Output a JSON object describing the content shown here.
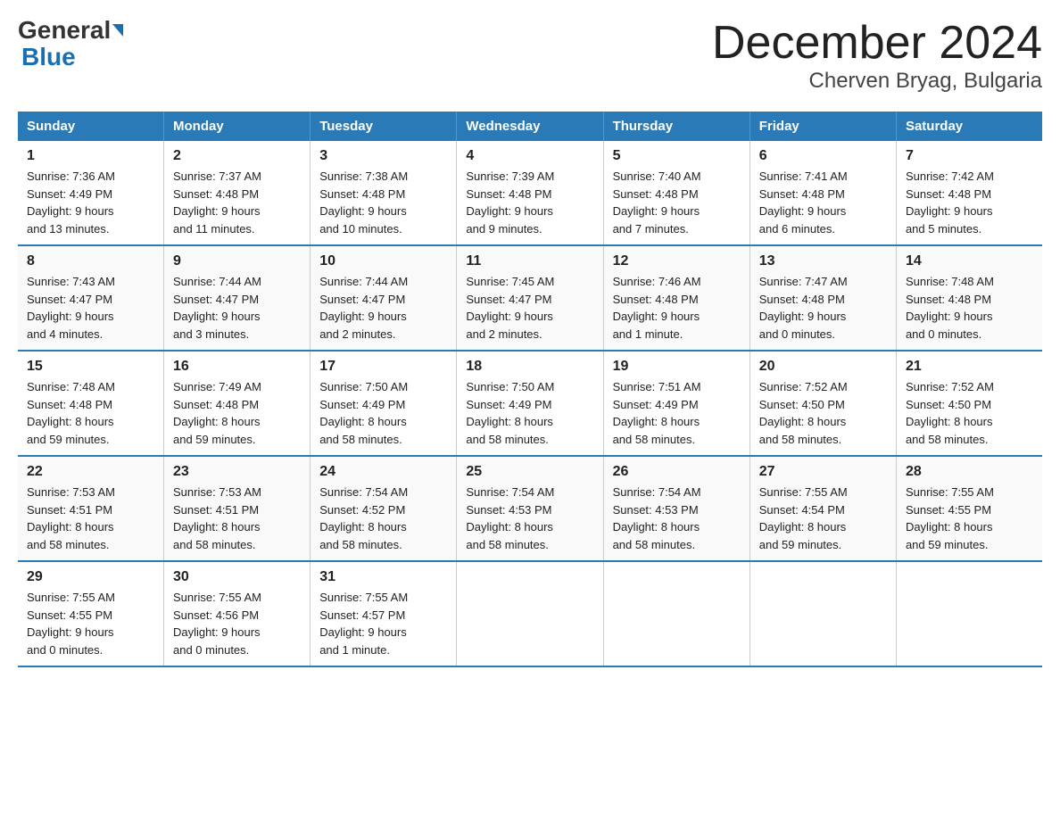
{
  "header": {
    "logo_general": "General",
    "logo_blue": "Blue",
    "title": "December 2024",
    "subtitle": "Cherven Bryag, Bulgaria"
  },
  "days_header": [
    "Sunday",
    "Monday",
    "Tuesday",
    "Wednesday",
    "Thursday",
    "Friday",
    "Saturday"
  ],
  "weeks": [
    [
      {
        "day": "1",
        "sunrise": "7:36 AM",
        "sunset": "4:49 PM",
        "daylight": "9 hours and 13 minutes."
      },
      {
        "day": "2",
        "sunrise": "7:37 AM",
        "sunset": "4:48 PM",
        "daylight": "9 hours and 11 minutes."
      },
      {
        "day": "3",
        "sunrise": "7:38 AM",
        "sunset": "4:48 PM",
        "daylight": "9 hours and 10 minutes."
      },
      {
        "day": "4",
        "sunrise": "7:39 AM",
        "sunset": "4:48 PM",
        "daylight": "9 hours and 9 minutes."
      },
      {
        "day": "5",
        "sunrise": "7:40 AM",
        "sunset": "4:48 PM",
        "daylight": "9 hours and 7 minutes."
      },
      {
        "day": "6",
        "sunrise": "7:41 AM",
        "sunset": "4:48 PM",
        "daylight": "9 hours and 6 minutes."
      },
      {
        "day": "7",
        "sunrise": "7:42 AM",
        "sunset": "4:48 PM",
        "daylight": "9 hours and 5 minutes."
      }
    ],
    [
      {
        "day": "8",
        "sunrise": "7:43 AM",
        "sunset": "4:47 PM",
        "daylight": "9 hours and 4 minutes."
      },
      {
        "day": "9",
        "sunrise": "7:44 AM",
        "sunset": "4:47 PM",
        "daylight": "9 hours and 3 minutes."
      },
      {
        "day": "10",
        "sunrise": "7:44 AM",
        "sunset": "4:47 PM",
        "daylight": "9 hours and 2 minutes."
      },
      {
        "day": "11",
        "sunrise": "7:45 AM",
        "sunset": "4:47 PM",
        "daylight": "9 hours and 2 minutes."
      },
      {
        "day": "12",
        "sunrise": "7:46 AM",
        "sunset": "4:48 PM",
        "daylight": "9 hours and 1 minute."
      },
      {
        "day": "13",
        "sunrise": "7:47 AM",
        "sunset": "4:48 PM",
        "daylight": "9 hours and 0 minutes."
      },
      {
        "day": "14",
        "sunrise": "7:48 AM",
        "sunset": "4:48 PM",
        "daylight": "9 hours and 0 minutes."
      }
    ],
    [
      {
        "day": "15",
        "sunrise": "7:48 AM",
        "sunset": "4:48 PM",
        "daylight": "8 hours and 59 minutes."
      },
      {
        "day": "16",
        "sunrise": "7:49 AM",
        "sunset": "4:48 PM",
        "daylight": "8 hours and 59 minutes."
      },
      {
        "day": "17",
        "sunrise": "7:50 AM",
        "sunset": "4:49 PM",
        "daylight": "8 hours and 58 minutes."
      },
      {
        "day": "18",
        "sunrise": "7:50 AM",
        "sunset": "4:49 PM",
        "daylight": "8 hours and 58 minutes."
      },
      {
        "day": "19",
        "sunrise": "7:51 AM",
        "sunset": "4:49 PM",
        "daylight": "8 hours and 58 minutes."
      },
      {
        "day": "20",
        "sunrise": "7:52 AM",
        "sunset": "4:50 PM",
        "daylight": "8 hours and 58 minutes."
      },
      {
        "day": "21",
        "sunrise": "7:52 AM",
        "sunset": "4:50 PM",
        "daylight": "8 hours and 58 minutes."
      }
    ],
    [
      {
        "day": "22",
        "sunrise": "7:53 AM",
        "sunset": "4:51 PM",
        "daylight": "8 hours and 58 minutes."
      },
      {
        "day": "23",
        "sunrise": "7:53 AM",
        "sunset": "4:51 PM",
        "daylight": "8 hours and 58 minutes."
      },
      {
        "day": "24",
        "sunrise": "7:54 AM",
        "sunset": "4:52 PM",
        "daylight": "8 hours and 58 minutes."
      },
      {
        "day": "25",
        "sunrise": "7:54 AM",
        "sunset": "4:53 PM",
        "daylight": "8 hours and 58 minutes."
      },
      {
        "day": "26",
        "sunrise": "7:54 AM",
        "sunset": "4:53 PM",
        "daylight": "8 hours and 58 minutes."
      },
      {
        "day": "27",
        "sunrise": "7:55 AM",
        "sunset": "4:54 PM",
        "daylight": "8 hours and 59 minutes."
      },
      {
        "day": "28",
        "sunrise": "7:55 AM",
        "sunset": "4:55 PM",
        "daylight": "8 hours and 59 minutes."
      }
    ],
    [
      {
        "day": "29",
        "sunrise": "7:55 AM",
        "sunset": "4:55 PM",
        "daylight": "9 hours and 0 minutes."
      },
      {
        "day": "30",
        "sunrise": "7:55 AM",
        "sunset": "4:56 PM",
        "daylight": "9 hours and 0 minutes."
      },
      {
        "day": "31",
        "sunrise": "7:55 AM",
        "sunset": "4:57 PM",
        "daylight": "9 hours and 1 minute."
      },
      null,
      null,
      null,
      null
    ]
  ],
  "labels": {
    "sunrise": "Sunrise:",
    "sunset": "Sunset:",
    "daylight": "Daylight:"
  }
}
